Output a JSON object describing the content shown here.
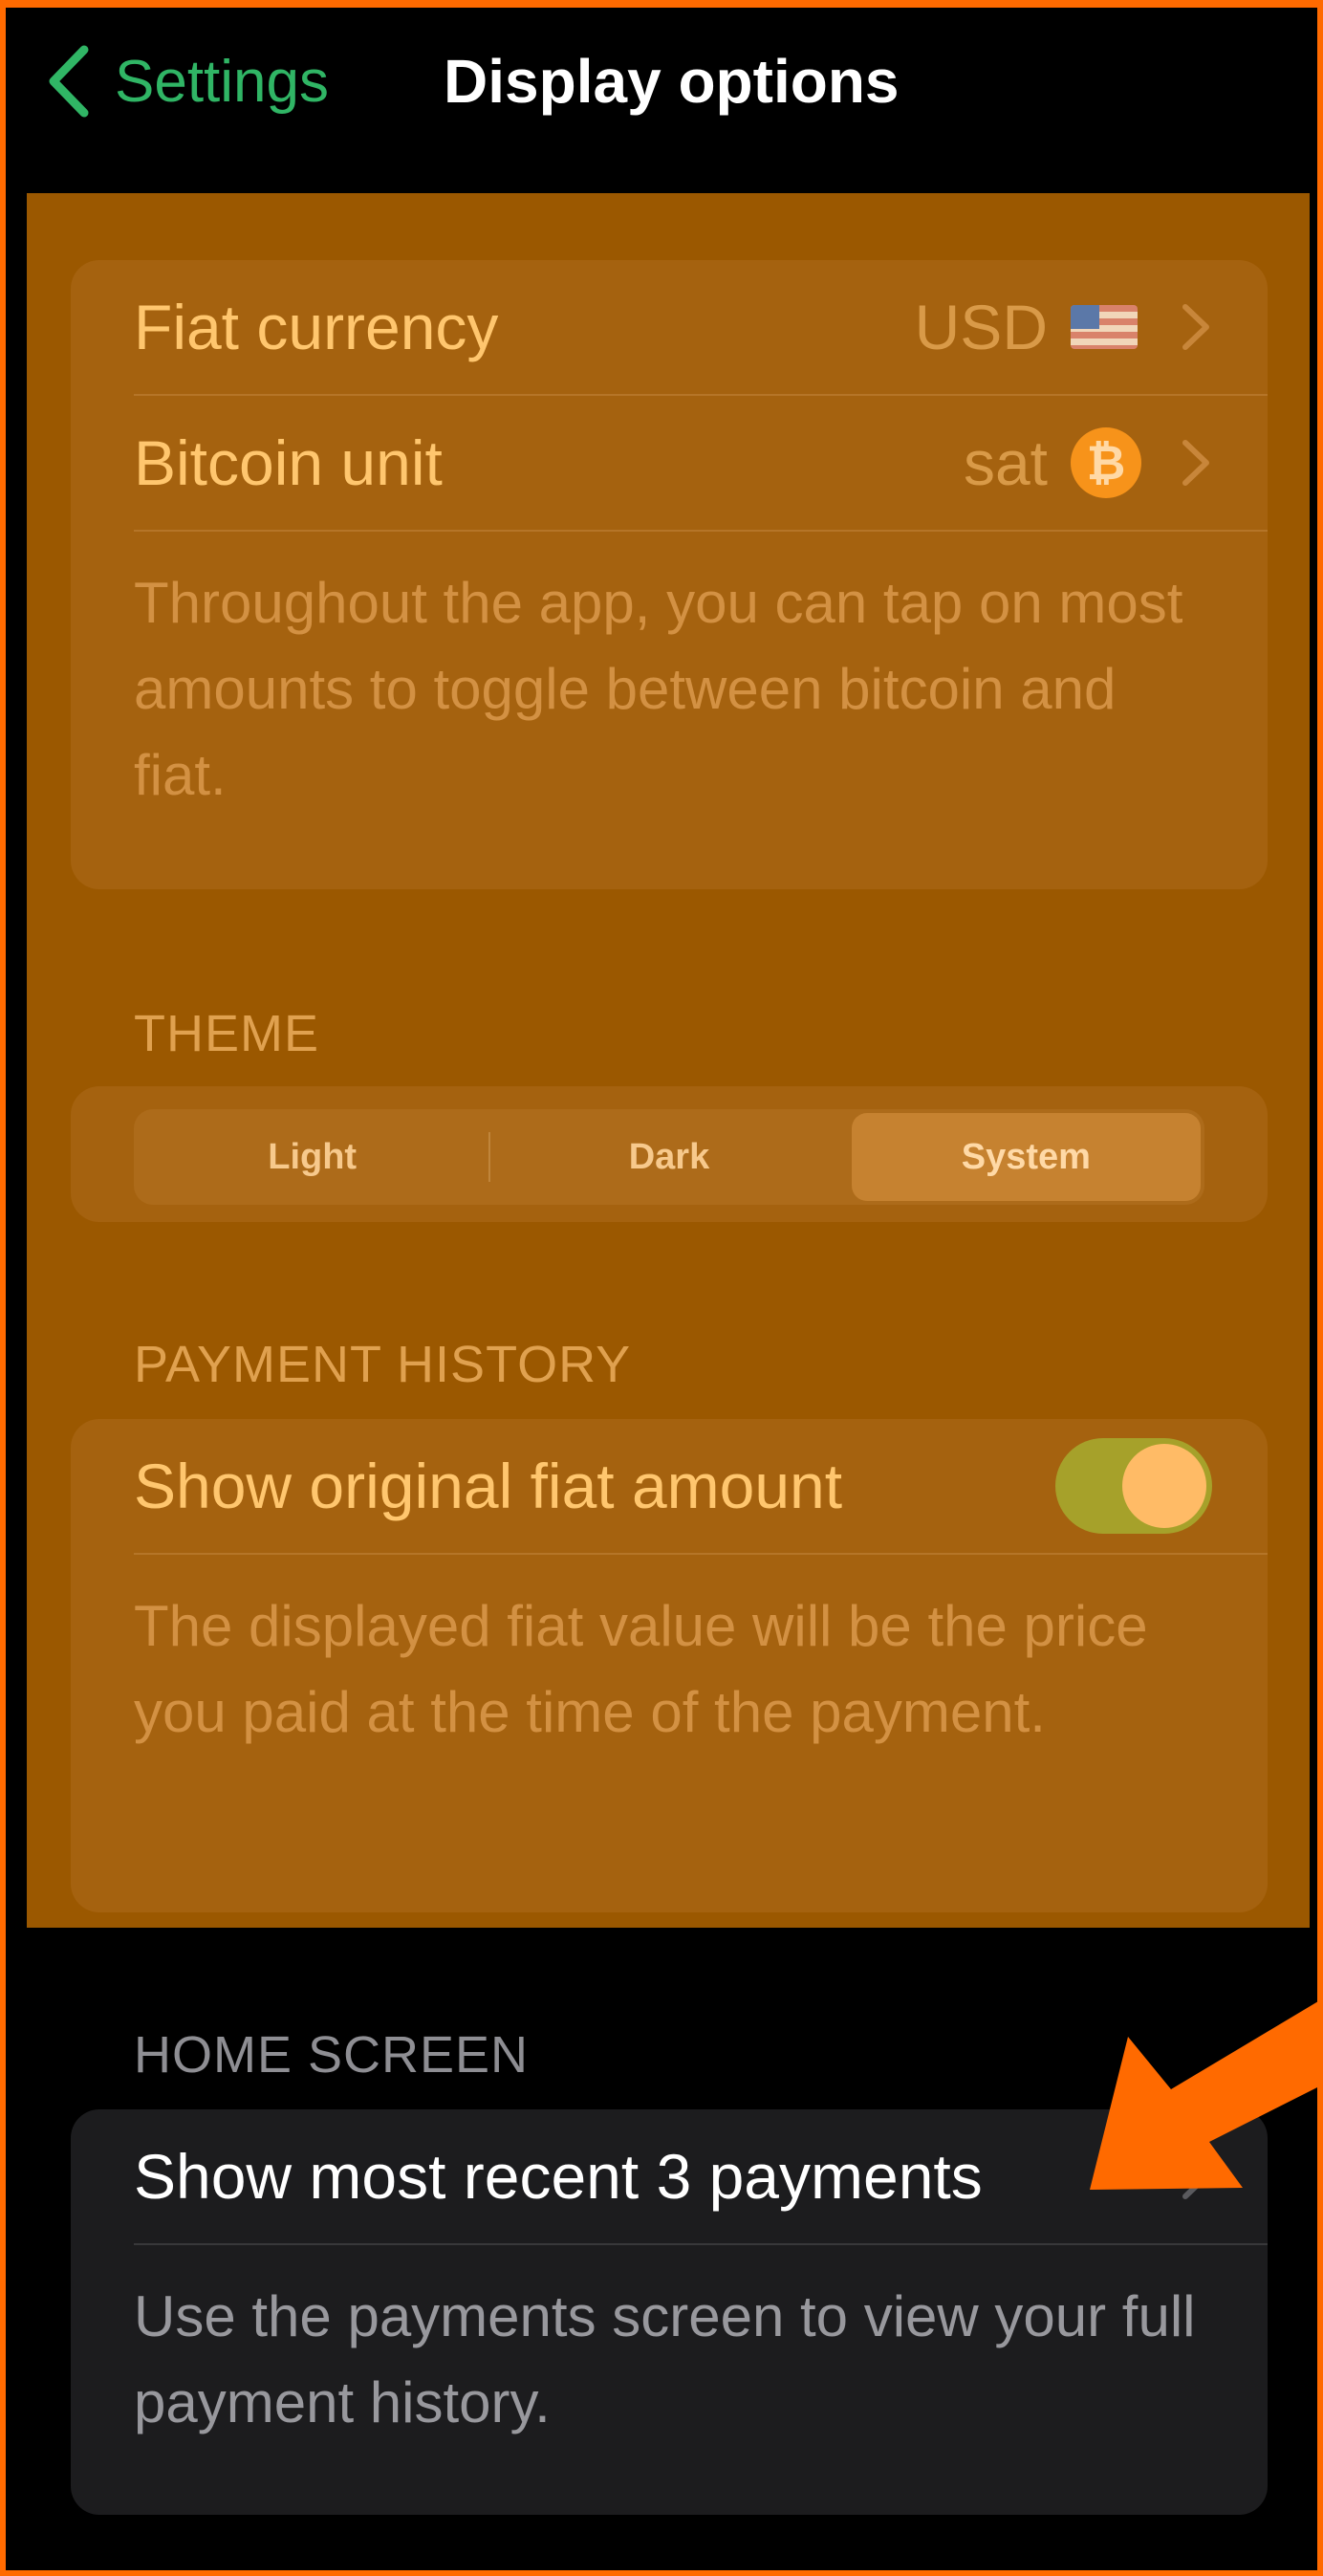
{
  "nav": {
    "back_label": "Settings",
    "title": "Display options"
  },
  "currency_section": {
    "fiat_label": "Fiat currency",
    "fiat_value": "USD",
    "fiat_flag_icon": "us-flag-icon",
    "bitcoin_label": "Bitcoin unit",
    "bitcoin_value": "sat",
    "bitcoin_icon": "bitcoin-icon",
    "footnote": "Throughout the app, you can tap on most amounts to toggle between bitcoin and fiat."
  },
  "theme_section": {
    "header": "THEME",
    "options": [
      "Light",
      "Dark",
      "System"
    ],
    "selected": "System"
  },
  "payment_history_section": {
    "header": "PAYMENT HISTORY",
    "toggle_label": "Show original fiat amount",
    "toggle_on": true,
    "footnote": "The displayed fiat value will be the price you paid at the time of the payment."
  },
  "home_screen_section": {
    "header": "HOME SCREEN",
    "row_label": "Show most recent 3 payments",
    "footnote": "Use the payments screen to view your full payment history."
  },
  "colors": {
    "accent_green": "#30b565",
    "highlight_overlay": "#9b5800",
    "annotation_orange": "#ff6a00"
  }
}
